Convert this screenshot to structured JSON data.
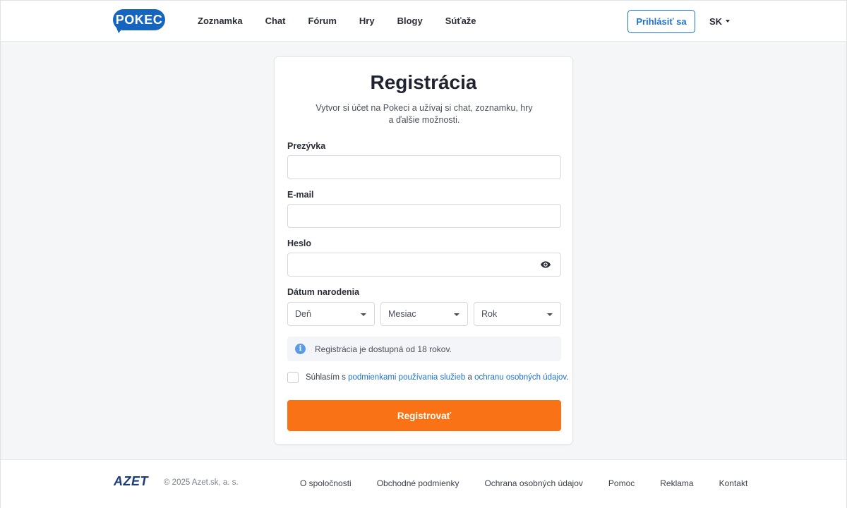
{
  "header": {
    "logo_text": "POKEC",
    "nav": [
      "Zoznamka",
      "Chat",
      "Fórum",
      "Hry",
      "Blogy",
      "Súťaže"
    ],
    "login_label": "Prihlásiť sa",
    "language": "SK"
  },
  "form": {
    "title": "Registrácia",
    "subtitle_line1": "Vytvor si účet na Pokeci a užívaj si chat, zoznamku, hry",
    "subtitle_line2": "a ďalšie možnosti.",
    "nickname_label": "Prezývka",
    "nickname_value": "",
    "email_label": "E-mail",
    "email_value": "",
    "password_label": "Heslo",
    "password_value": "",
    "password_toggle_icon": "eye-icon",
    "birthdate_label": "Dátum narodenia",
    "day_placeholder": "Deň",
    "month_placeholder": "Mesiac",
    "year_placeholder": "Rok",
    "info_icon": "info-icon",
    "info_text": "Registrácia je dostupná od 18 rokov.",
    "consent_prefix": "Súhlasím s ",
    "consent_terms_link": "podmienkami používania služieb",
    "consent_middle": " a ",
    "consent_privacy_link": "ochranu osobných údajov",
    "consent_suffix": ".",
    "consent_checked": false,
    "submit_label": "Registrovať"
  },
  "footer": {
    "brand": "AZET",
    "copyright": "© 2025 Azet.sk, a. s.",
    "links": [
      "O spoločnosti",
      "Obchodné podmienky",
      "Ochrana osobných údajov",
      "Pomoc",
      "Reklama",
      "Kontakt"
    ]
  },
  "colors": {
    "brand_blue": "#1565c0",
    "link_blue": "#1e73c9",
    "accent_orange": "#f97316",
    "info_blue": "#5b9be3"
  }
}
